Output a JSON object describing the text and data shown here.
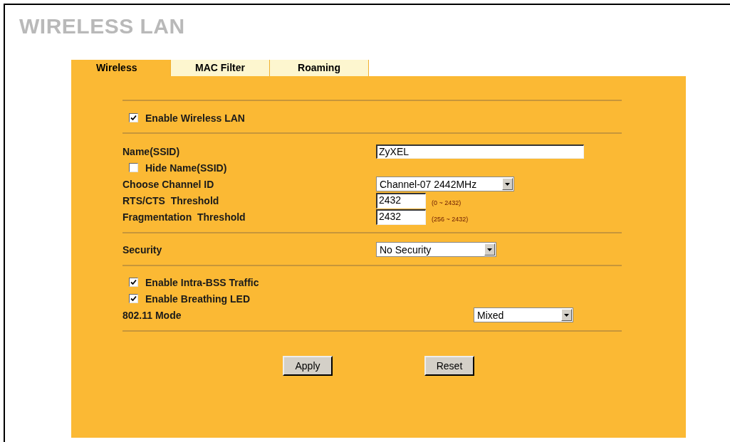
{
  "title": "WIRELESS LAN",
  "tabs": [
    {
      "label": "Wireless",
      "selected": true
    },
    {
      "label": "MAC Filter",
      "selected": false
    },
    {
      "label": "Roaming",
      "selected": false
    }
  ],
  "sections": [
    {
      "rows": [
        {
          "kind": "checkbox",
          "label": "Enable Wireless LAN",
          "checked": true
        }
      ]
    },
    {
      "rows": [
        {
          "kind": "text",
          "label": "Name(SSID)",
          "value": "ZyXEL"
        },
        {
          "kind": "checkbox",
          "label": "Hide Name(SSID)",
          "checked": false
        },
        {
          "kind": "select",
          "label": "Choose Channel ID",
          "value": "Channel-07 2442MHz"
        },
        {
          "kind": "number",
          "label": "RTS/CTS  Threshold",
          "value": "2432",
          "hint": "(0 ~ 2432)"
        },
        {
          "kind": "number",
          "label": "Fragmentation  Threshold",
          "value": "2432",
          "hint": "(256 ~ 2432)"
        }
      ]
    },
    {
      "rows": [
        {
          "kind": "select",
          "label": "Security",
          "value": "No Security"
        }
      ]
    },
    {
      "rows": [
        {
          "kind": "checkbox",
          "label": "Enable Intra-BSS Traffic",
          "checked": true
        },
        {
          "kind": "checkbox",
          "label": "Enable Breathing LED",
          "checked": true
        },
        {
          "kind": "farselect",
          "label": "802.11 Mode",
          "value": "Mixed"
        }
      ]
    }
  ],
  "buttons": [
    "Apply",
    "Reset"
  ]
}
